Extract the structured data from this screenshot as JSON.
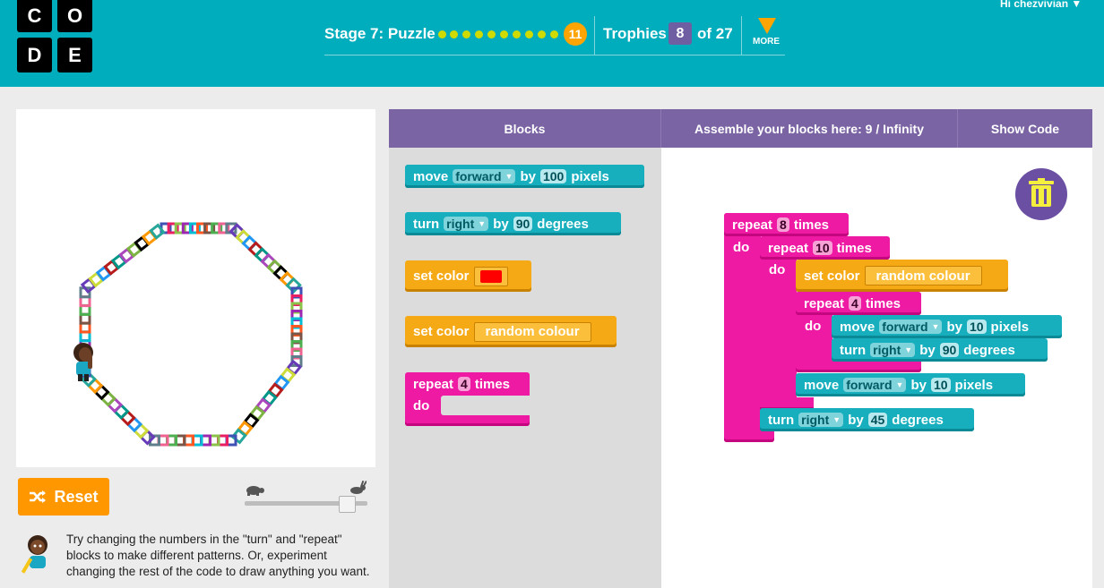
{
  "logo": {
    "letters": [
      "C",
      "O",
      "D",
      "E"
    ]
  },
  "header": {
    "stage_label": "Stage 7: Puzzle",
    "puzzle_number": "11",
    "trophies_label": "Trophies",
    "trophies_count": "8",
    "trophies_total": "of 27",
    "more_label": "MORE",
    "user_greeting": "Hi chezvivian"
  },
  "colors": {
    "header": "#00adbc",
    "toolbar": "#7b64a4",
    "teal_block": "#17aebd",
    "orange_block": "#f5a915",
    "pink_block": "#ef1aa3",
    "reset": "#ff9800"
  },
  "controls": {
    "reset_label": "Reset",
    "speed_slow_icon": "turtle-icon",
    "speed_fast_icon": "rabbit-icon",
    "speed_level": 0.95
  },
  "instructions": "Try changing the numbers in the \"turn\" and \"repeat\" blocks to make different patterns. Or, experiment changing the rest of the code to draw anything you want.",
  "toolbar": {
    "blocks_label": "Blocks",
    "assemble_label": "Assemble your blocks here: 9 / Infinity",
    "show_code_label": "Show Code"
  },
  "toolbox": {
    "move": {
      "kw": "move",
      "dir": "forward",
      "by": "by",
      "amount": "100",
      "unit": "pixels"
    },
    "turn": {
      "kw": "turn",
      "dir": "right",
      "by": "by",
      "amount": "90",
      "unit": "degrees"
    },
    "set_color": {
      "kw": "set color",
      "swatch": "#ff0000"
    },
    "set_random": {
      "kw": "set color",
      "value": "random colour"
    },
    "repeat": {
      "kw": "repeat",
      "count": "4",
      "times": "times",
      "do": "do"
    }
  },
  "program": {
    "outer_repeat": {
      "kw": "repeat",
      "count": "8",
      "times": "times",
      "do": "do"
    },
    "inner_repeat": {
      "kw": "repeat",
      "count": "10",
      "times": "times",
      "do": "do"
    },
    "set_color": {
      "kw": "set color",
      "value": "random colour"
    },
    "square_repeat": {
      "kw": "repeat",
      "count": "4",
      "times": "times",
      "do": "do"
    },
    "move_inner": {
      "kw": "move",
      "dir": "forward",
      "by": "by",
      "amount": "10",
      "unit": "pixels"
    },
    "turn_inner": {
      "kw": "turn",
      "dir": "right",
      "by": "by",
      "amount": "90",
      "unit": "degrees"
    },
    "move_outer": {
      "kw": "move",
      "dir": "forward",
      "by": "by",
      "amount": "10",
      "unit": "pixels"
    },
    "turn_outer": {
      "kw": "turn",
      "dir": "right",
      "by": "by",
      "amount": "45",
      "unit": "degrees"
    }
  }
}
